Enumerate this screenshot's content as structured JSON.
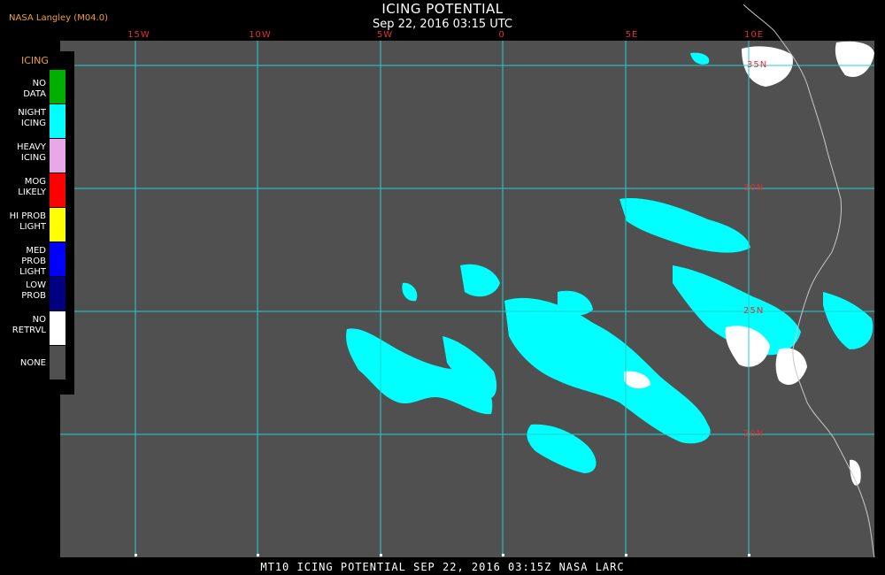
{
  "header": {
    "title": "ICING POTENTIAL",
    "date": "Sep 22, 2016 03:15 UTC",
    "producer": "NASA Langley (M04.0)"
  },
  "map": {
    "lon_labels": [
      "15W",
      "10W",
      "5W",
      "0",
      "5E",
      "10E"
    ],
    "lat_labels": [
      "35N",
      "30N",
      "25N",
      "20N"
    ],
    "colors": {
      "background": "#505050",
      "grid": "#20d0d0",
      "night_icing": "#00ffff",
      "no_retrieval": "#ffffff",
      "coastline": "#c8c8c8"
    }
  },
  "legend": {
    "heading": "ICING",
    "items": [
      {
        "label": "NO DATA",
        "color": "#00b000"
      },
      {
        "label": "NIGHT ICING",
        "color": "#00ffff"
      },
      {
        "label": "HEAVY ICING",
        "color": "#e8a8e8"
      },
      {
        "label": "MOG LIKELY",
        "color": "#ff0000"
      },
      {
        "label": "HI PROB LIGHT",
        "color": "#ffff00"
      },
      {
        "label": "MED PROB LIGHT",
        "color": "#0000ff"
      },
      {
        "label": "LOW PROB",
        "color": "#000080"
      },
      {
        "label": "NO RETRVL",
        "color": "#ffffff"
      },
      {
        "label": "NONE",
        "color": "#505050"
      }
    ]
  },
  "footer": {
    "text": "MT10  ICING POTENTIAL   SEP 22, 2016 03:15Z   NASA LARC"
  }
}
